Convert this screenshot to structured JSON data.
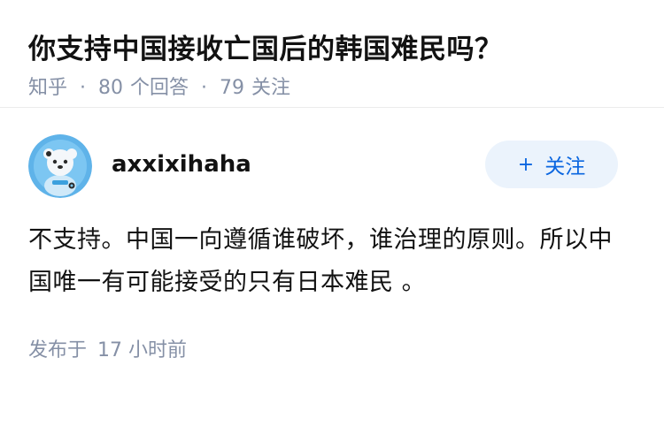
{
  "question": {
    "title": "你支持中国接收亡国后的韩国难民吗？",
    "source": "知乎",
    "separator": "·",
    "answers_count": "80",
    "answers_label": "个回答",
    "followers_count": "79",
    "followers_label": "关注"
  },
  "answer": {
    "author_name": "axxixihaha",
    "avatar_icon": "cartoon-bear-avatar-icon",
    "follow_label": "关注",
    "follow_icon": "plus-icon",
    "text": "不支持。中国一向遵循谁破坏，谁治理的原则。所以中国唯一有可能接受的只有日本难民 。",
    "time_label": "发布于",
    "time_value": "17 小时前"
  },
  "colors": {
    "accent": "#0a66e0",
    "follow_bg": "#ebf3fc",
    "meta": "#8590a6",
    "text": "#121212"
  }
}
